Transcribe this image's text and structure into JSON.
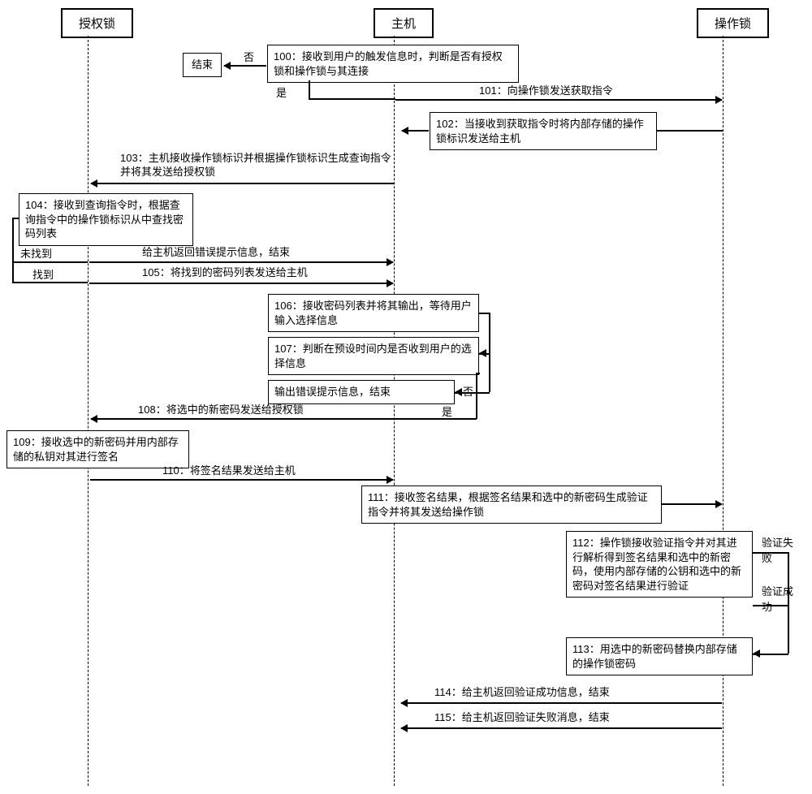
{
  "actors": {
    "auth_lock": "授权锁",
    "host": "主机",
    "op_lock": "操作锁"
  },
  "steps": {
    "s100": "100：接收到用户的触发信息时，判断是否有授权锁和操作锁与其连接",
    "s101": "101：向操作锁发送获取指令",
    "s102": "102：当接收到获取指令时将内部存储的操作锁标识发送给主机",
    "s103": "103：主机接收操作锁标识并根据操作锁标识生成查询指令并将其发送给授权锁",
    "s104": "104：接收到查询指令时，根据查询指令中的操作锁标识从中查找密码列表",
    "s104_err": "给主机返回错误提示信息，结束",
    "s105": "105：将找到的密码列表发送给主机",
    "s106": "106：接收密码列表并将其输出，等待用户输入选择信息",
    "s107": "107：判断在预设时间内是否收到用户的选择信息",
    "s107_err": "输出错误提示信息，结束",
    "s108": "108：将选中的新密码发送给授权锁",
    "s109": "109：接收选中的新密码并用内部存储的私钥对其进行签名",
    "s110": "110：将签名结果发送给主机",
    "s111": "111：接收签名结果，根据签名结果和选中的新密码生成验证指令并将其发送给操作锁",
    "s112": "112：操作锁接收验证指令并对其进行解析得到签名结果和选中的新密码，使用内部存储的公钥和选中的新密码对签名结果进行验证",
    "s113": "113：用选中的新密码替换内部存储的操作锁密码",
    "s114": "114：给主机返回验证成功信息，结束",
    "s115": "115：给主机返回验证失败消息，结束"
  },
  "labels": {
    "end": "结束",
    "no": "否",
    "yes": "是",
    "not_found": "未找到",
    "found": "找到",
    "verify_fail": "验证失败",
    "verify_success": "验证成功"
  }
}
